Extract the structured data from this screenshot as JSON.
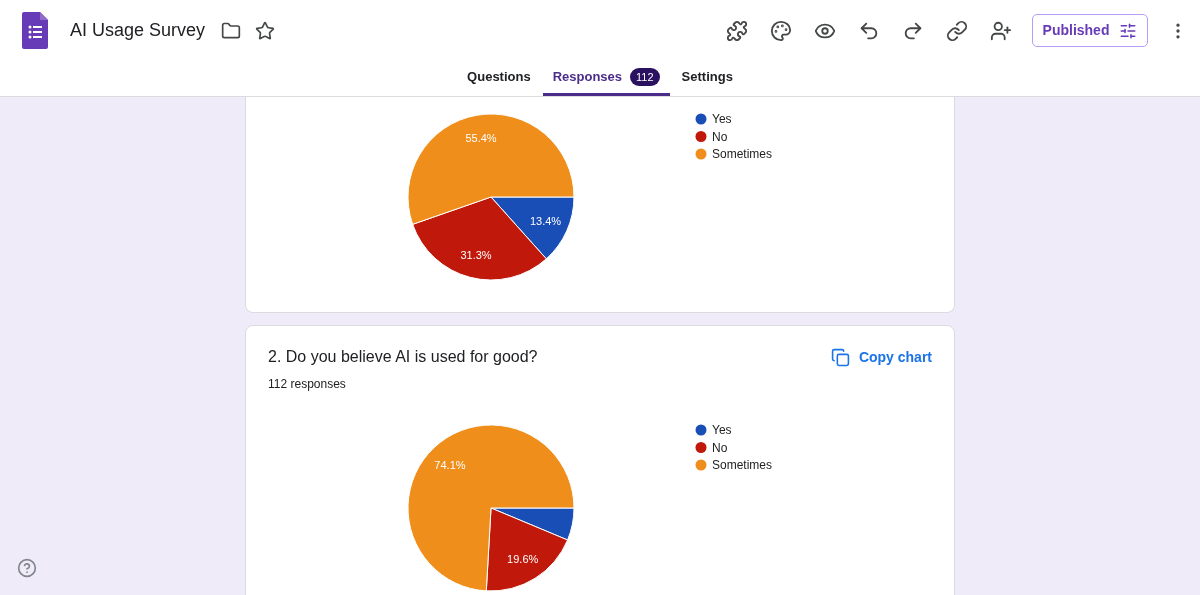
{
  "app": {
    "title": "AI Usage Survey",
    "publish_button": "Published"
  },
  "tabs": [
    {
      "label": "Questions",
      "selected": false
    },
    {
      "label": "Responses",
      "selected": true,
      "badge": "112"
    },
    {
      "label": "Settings",
      "selected": false
    }
  ],
  "cards": [
    {
      "chart_data": {
        "type": "pie",
        "categories": [
          "Yes",
          "No",
          "Sometimes"
        ],
        "colors": [
          "#1a4eb7",
          "#c0190b",
          "#ef8e1a"
        ],
        "values": [
          13.4,
          31.3,
          55.4
        ],
        "value_labels": [
          "13.4%",
          "31.3%",
          "55.4%"
        ],
        "legend": "right"
      }
    },
    {
      "title": "2. Do you believe AI is used for good?",
      "responses": "112 responses",
      "copy_button": "Copy chart",
      "chart_data": {
        "type": "pie",
        "categories": [
          "Yes",
          "No",
          "Sometimes"
        ],
        "colors": [
          "#1a4eb7",
          "#c0190b",
          "#ef8e1a"
        ],
        "values": [
          6.3,
          19.6,
          74.1
        ],
        "value_labels": [
          null,
          "19.6%",
          "74.1%"
        ],
        "legend": "right"
      }
    }
  ]
}
